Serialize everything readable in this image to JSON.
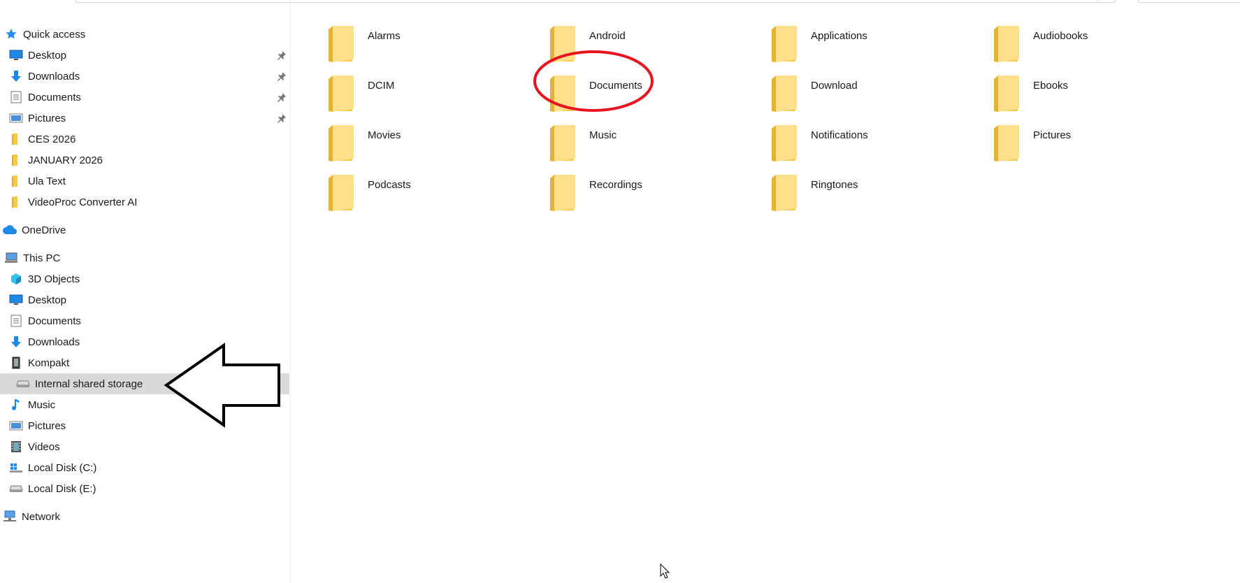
{
  "sidebar": {
    "quick_access": {
      "header": "Quick access",
      "items": [
        {
          "label": "Desktop",
          "icon": "desktop-icon",
          "pinned": true
        },
        {
          "label": "Downloads",
          "icon": "download-icon",
          "pinned": true
        },
        {
          "label": "Documents",
          "icon": "documents-icon",
          "pinned": true
        },
        {
          "label": "Pictures",
          "icon": "pictures-icon",
          "pinned": true
        },
        {
          "label": "CES 2026",
          "icon": "folder-icon",
          "pinned": false
        },
        {
          "label": "JANUARY 2026",
          "icon": "folder-icon",
          "pinned": false
        },
        {
          "label": "Ula Text",
          "icon": "folder-icon",
          "pinned": false
        },
        {
          "label": "VideoProc Converter AI",
          "icon": "folder-icon",
          "pinned": false
        }
      ]
    },
    "onedrive": {
      "header": "OneDrive"
    },
    "this_pc": {
      "header": "This PC",
      "items": [
        {
          "label": "3D Objects",
          "icon": "3d-objects-icon"
        },
        {
          "label": "Desktop",
          "icon": "desktop-icon"
        },
        {
          "label": "Documents",
          "icon": "documents-icon"
        },
        {
          "label": "Downloads",
          "icon": "download-icon"
        },
        {
          "label": "Kompakt",
          "icon": "phone-icon"
        },
        {
          "label": "Internal shared storage",
          "icon": "storage-drive-icon",
          "selected": true
        },
        {
          "label": "Music",
          "icon": "music-icon"
        },
        {
          "label": "Pictures",
          "icon": "pictures-icon"
        },
        {
          "label": "Videos",
          "icon": "videos-icon"
        },
        {
          "label": "Local Disk (C:)",
          "icon": "windows-drive-icon"
        },
        {
          "label": "Local Disk (E:)",
          "icon": "drive-icon"
        }
      ]
    },
    "network": {
      "header": "Network"
    }
  },
  "content": {
    "folders": [
      {
        "name": "Alarms"
      },
      {
        "name": "Android"
      },
      {
        "name": "Applications"
      },
      {
        "name": "Audiobooks"
      },
      {
        "name": "DCIM"
      },
      {
        "name": "Documents",
        "highlighted": true
      },
      {
        "name": "Download"
      },
      {
        "name": "Ebooks"
      },
      {
        "name": "Movies"
      },
      {
        "name": "Music"
      },
      {
        "name": "Notifications"
      },
      {
        "name": "Pictures"
      },
      {
        "name": "Podcasts"
      },
      {
        "name": "Recordings"
      },
      {
        "name": "Ringtones"
      }
    ]
  },
  "annotations": {
    "circle_color": "#e8141f",
    "arrow_color": "#000000"
  },
  "colors": {
    "selection": "#d9d9d9",
    "folder_light": "#ffe08a",
    "folder_dark": "#f2c24f",
    "accent_blue": "#1e90ff"
  }
}
